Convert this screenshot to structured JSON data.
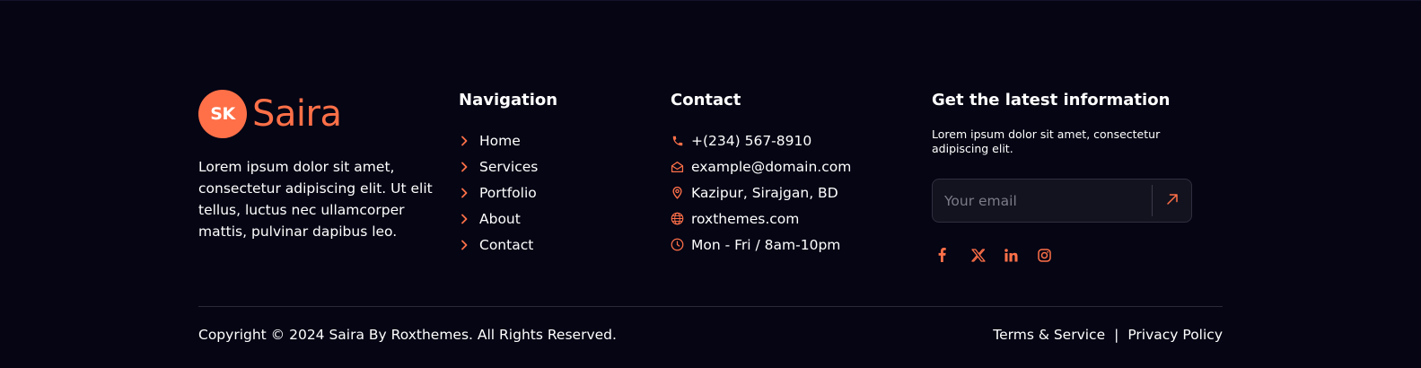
{
  "brand": {
    "badge": "SK",
    "name": "Saira",
    "description": "Lorem ipsum dolor sit amet, consectetur adipiscing elit. Ut elit tellus, luctus nec ullamcorper mattis, pulvinar dapibus leo."
  },
  "navigation": {
    "title": "Navigation",
    "items": [
      {
        "label": "Home"
      },
      {
        "label": "Services"
      },
      {
        "label": "Portfolio"
      },
      {
        "label": "About"
      },
      {
        "label": "Contact"
      }
    ]
  },
  "contact": {
    "title": "Contact",
    "items": [
      {
        "icon": "phone-icon",
        "label": "+(234) 567-8910"
      },
      {
        "icon": "mail-icon",
        "label": "example@domain.com"
      },
      {
        "icon": "location-pin-icon",
        "label": "Kazipur, Sirajgan, BD"
      },
      {
        "icon": "globe-icon",
        "label": "roxthemes.com"
      },
      {
        "icon": "clock-icon",
        "label": "Mon - Fri / 8am-10pm"
      }
    ]
  },
  "newsletter": {
    "title": "Get the latest information",
    "text": "Lorem ipsum dolor sit amet, consectetur adipiscing elit.",
    "email_placeholder": "Your email",
    "email_value": "",
    "submit_icon": "arrow-up-right-icon"
  },
  "socials": [
    {
      "icon": "facebook-icon"
    },
    {
      "icon": "x-twitter-icon"
    },
    {
      "icon": "linkedin-icon"
    },
    {
      "icon": "instagram-icon"
    }
  ],
  "footer": {
    "copyright": "Copyright © 2024 Saira By Roxthemes. All Rights Reserved.",
    "terms": "Terms & Service",
    "separator": "|",
    "privacy": "Privacy Policy"
  },
  "colors": {
    "background": "#050514",
    "accent": "#ff7048",
    "text": "#ffffff",
    "divider": "#2a2a3a"
  }
}
